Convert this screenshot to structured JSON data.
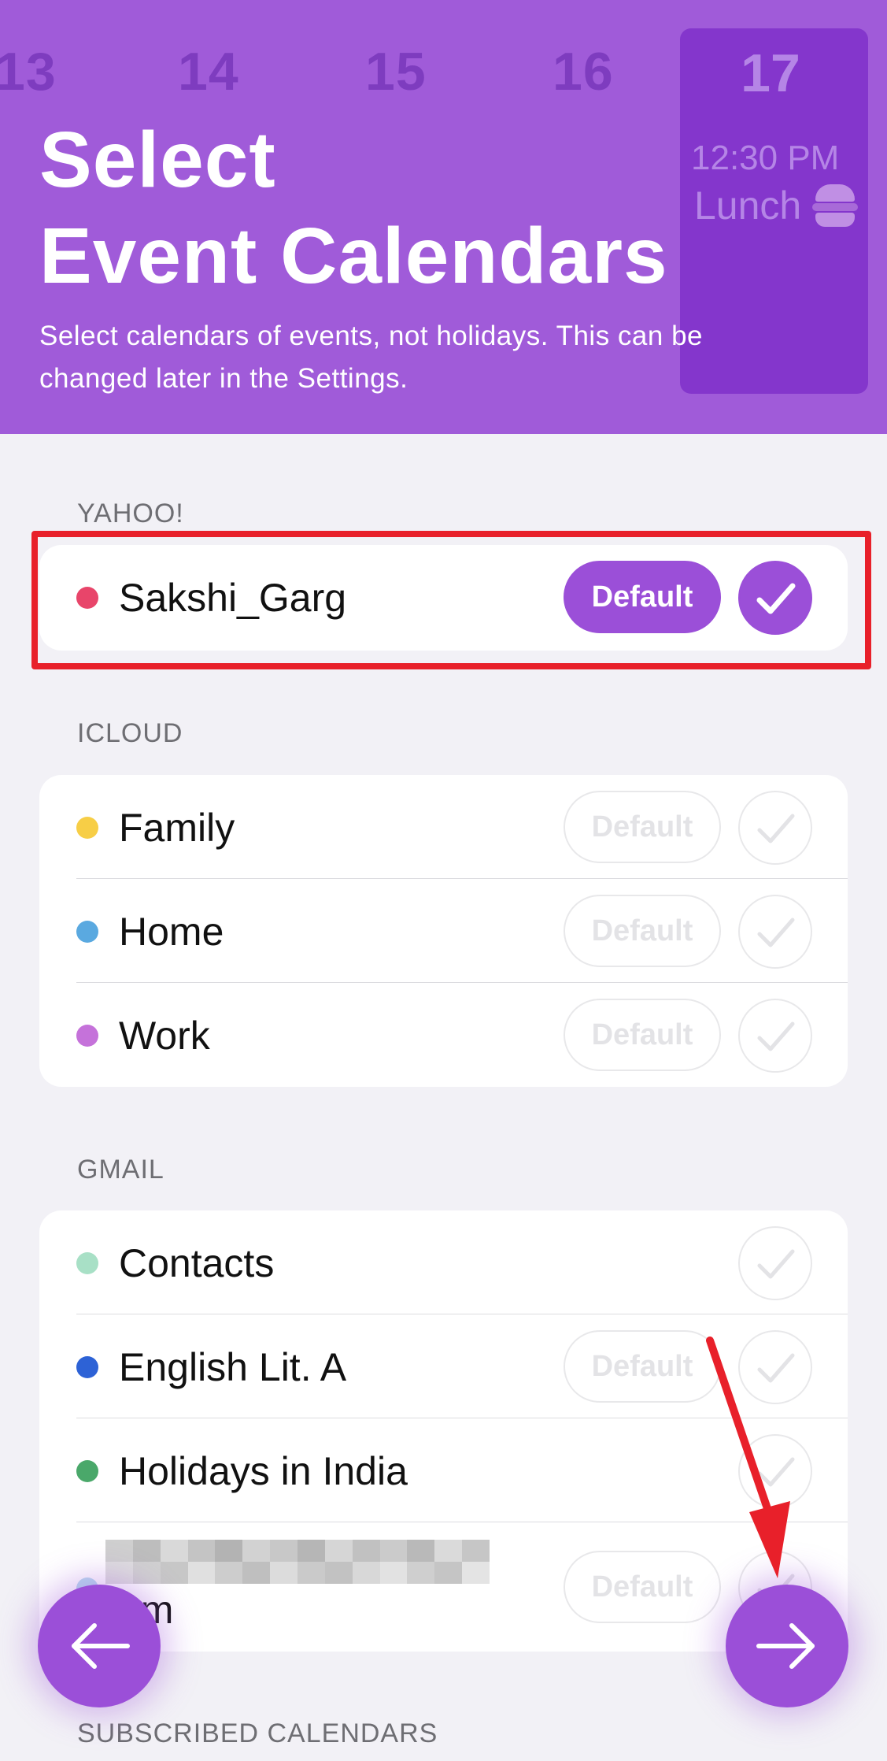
{
  "header": {
    "days": [
      "13",
      "14",
      "15",
      "16"
    ],
    "today": {
      "day": "17",
      "time": "12:30 PM",
      "event": "Lunch"
    },
    "title_line1": "Select",
    "title_line2": "Event Calendars",
    "subtitle": "Select calendars of events, not holidays. This can be changed later in the Settings."
  },
  "sections": {
    "yahoo": {
      "label": "YAHOO!",
      "rows": [
        {
          "name": "Sakshi_Garg",
          "dot_color": "#e8456a",
          "default_label": "Default",
          "is_default": true,
          "checked": true
        }
      ]
    },
    "icloud": {
      "label": "ICLOUD",
      "rows": [
        {
          "name": "Family",
          "dot_color": "#f7ce46",
          "default_label": "Default",
          "is_default": false,
          "checked": false
        },
        {
          "name": "Home",
          "dot_color": "#5aa9e0",
          "default_label": "Default",
          "is_default": false,
          "checked": false
        },
        {
          "name": "Work",
          "dot_color": "#c572da",
          "default_label": "Default",
          "is_default": false,
          "checked": false
        }
      ]
    },
    "gmail": {
      "label": "GMAIL",
      "rows": [
        {
          "name": "Contacts",
          "dot_color": "#a8e0c6",
          "checked": false
        },
        {
          "name": "English Lit. A",
          "dot_color": "#2d62d6",
          "default_label": "Default",
          "checked": false
        },
        {
          "name": "Holidays in India",
          "dot_color": "#4aa86a",
          "checked": false
        },
        {
          "name": "om",
          "dot_color": "#b9dcf0",
          "default_label": "Default",
          "checked": false
        }
      ]
    },
    "subscribed": {
      "label": "SUBSCRIBED CALENDARS"
    }
  },
  "nav": {
    "back_icon": "arrow-left-icon",
    "next_icon": "arrow-right-icon"
  },
  "colors": {
    "accent": "#9b4fd8",
    "header_bg": "#a05bd9",
    "annotation": "#e8202a"
  }
}
